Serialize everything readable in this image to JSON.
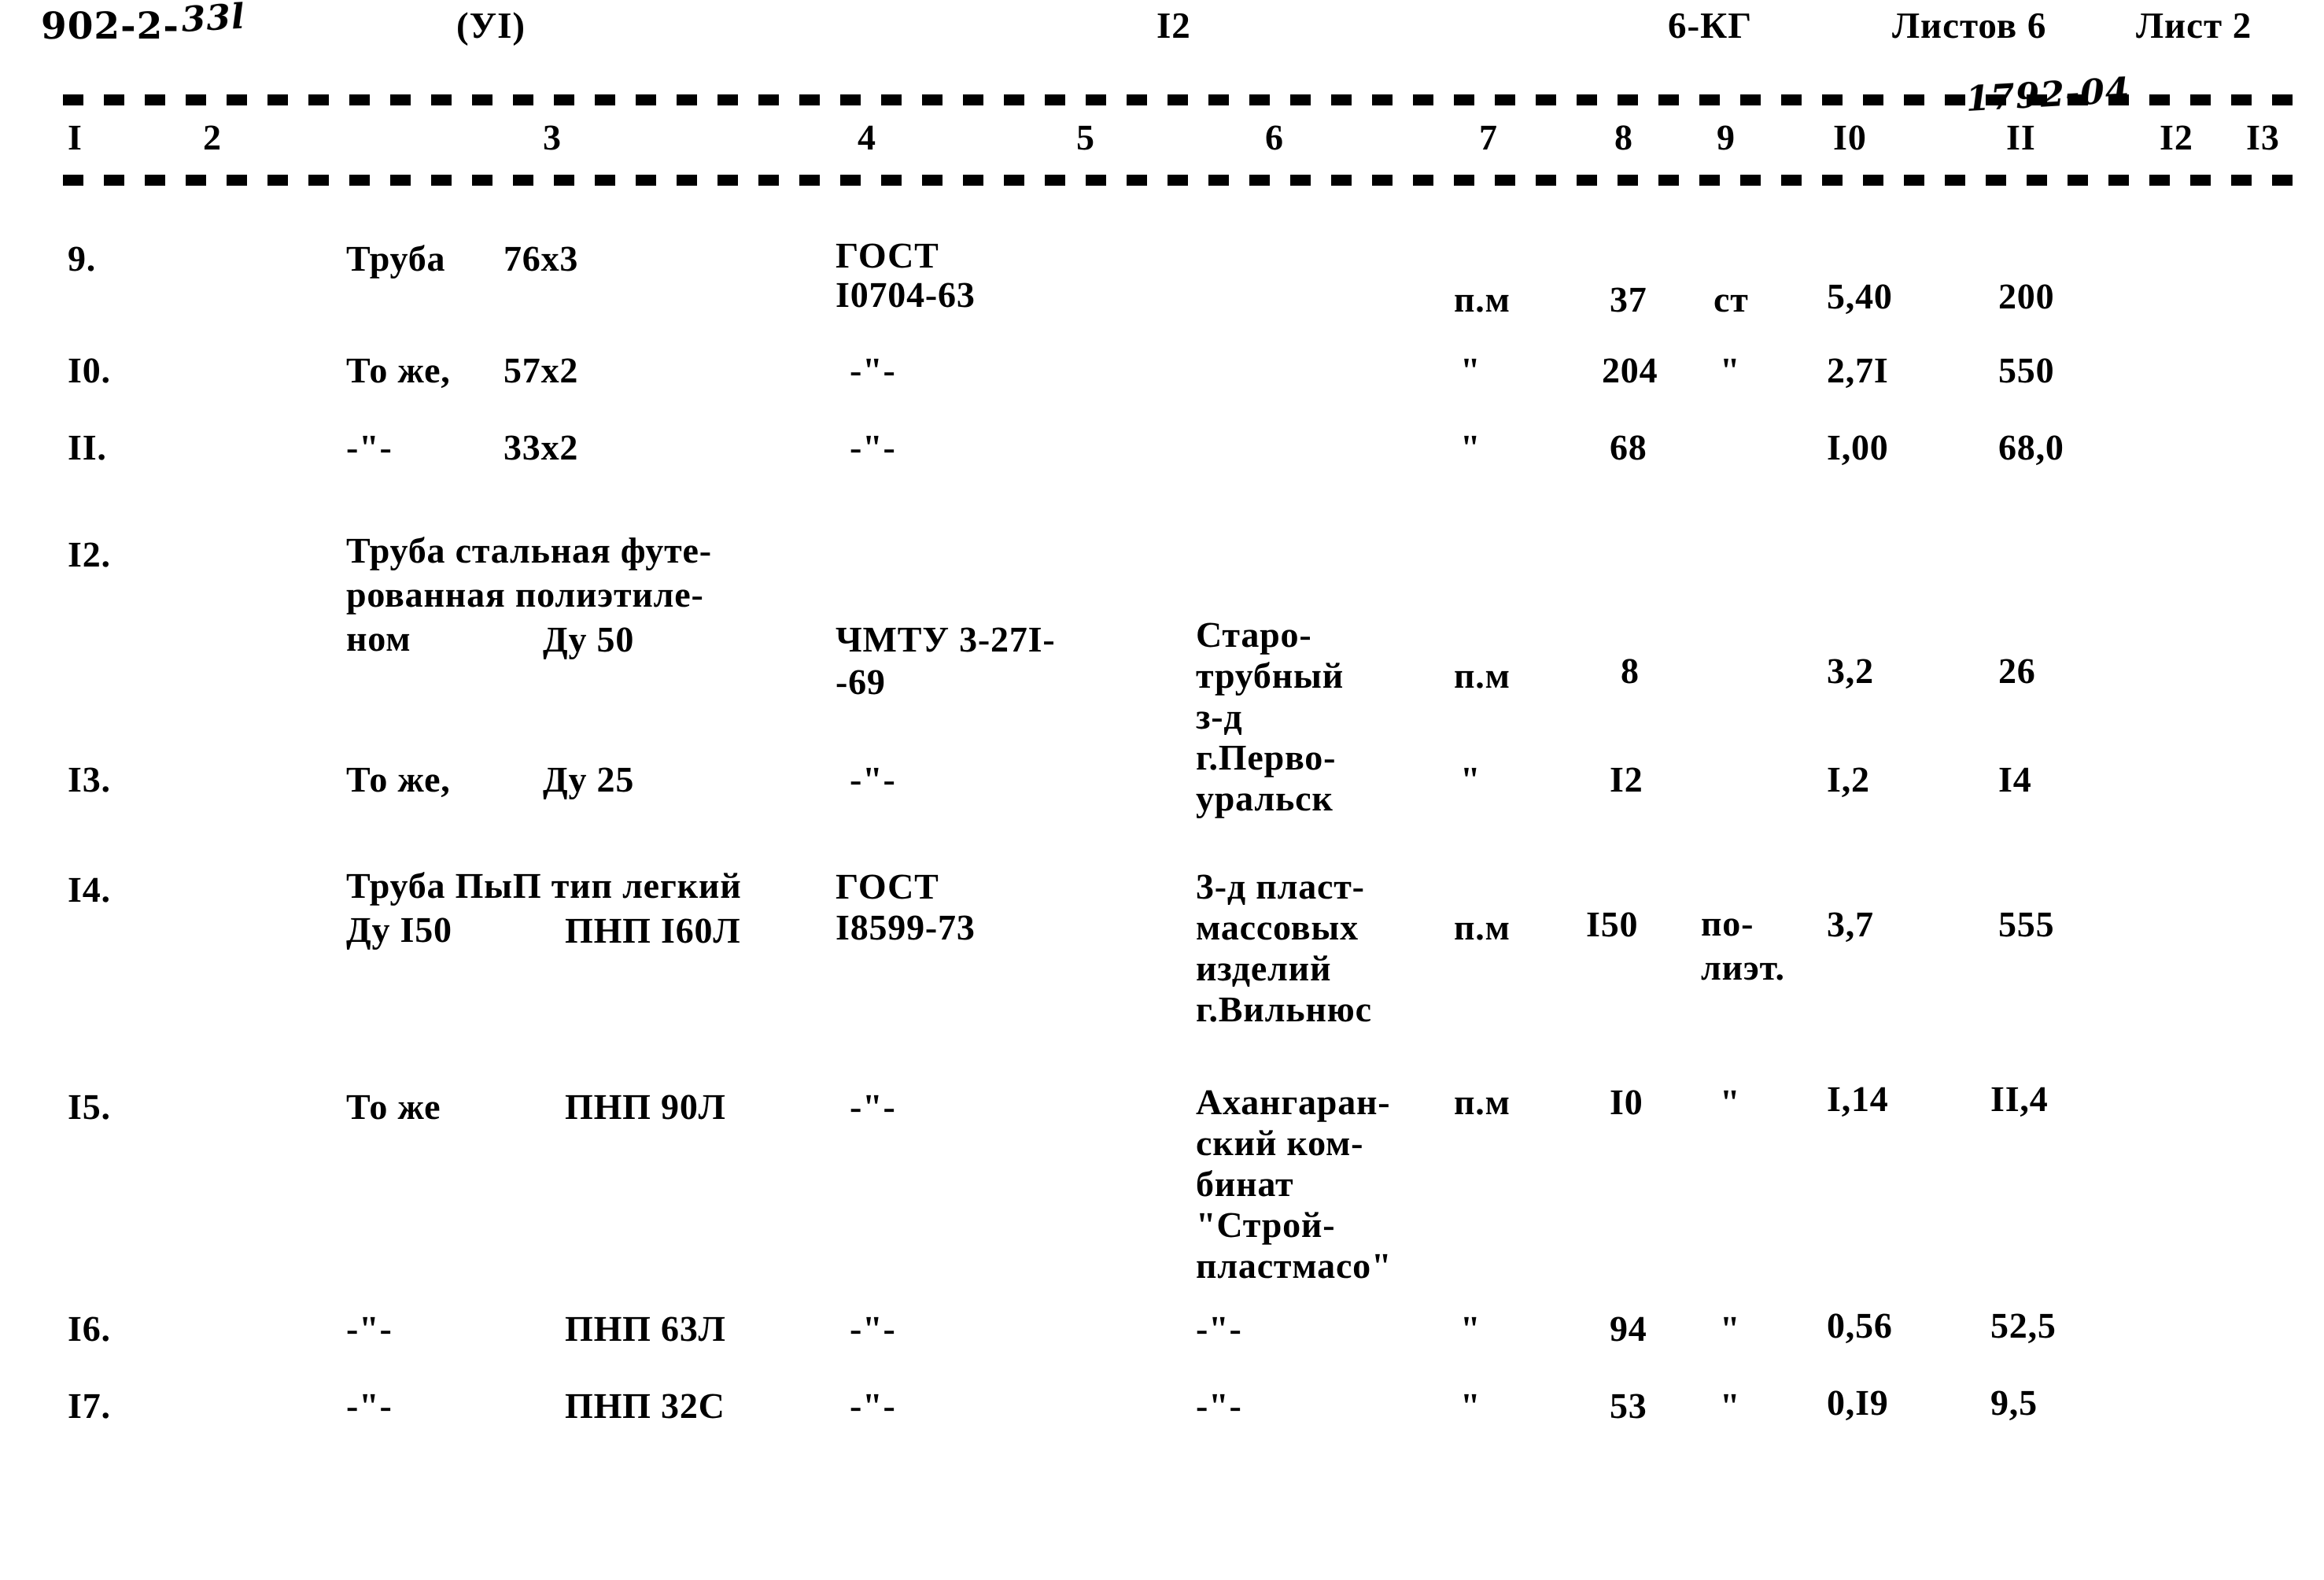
{
  "document": {
    "series_code": "902-2-",
    "series_code_handwritten": "33l",
    "section": "(УI)",
    "center_number": "I2",
    "mark": "6-КГ",
    "sheets_total_label": "Листов 6",
    "sheet_label": "Лист 2",
    "handwritten_note": "1792-04"
  },
  "table": {
    "column_numbers": [
      "I",
      "2",
      "3",
      "4",
      "5",
      "6",
      "7",
      "8",
      "9",
      "I0",
      "II",
      "I2",
      "I3"
    ],
    "ditto_mark": "-\"-",
    "quote_mark": "\"",
    "rows": [
      {
        "num": "9.",
        "c3a": "Труба",
        "c3b": "76х3",
        "c4": [
          "ГОСТ",
          "I0704-63"
        ],
        "c5": "",
        "c6": [],
        "c7": "п.м",
        "c8": "37",
        "c9": "ст",
        "c10": "5,40",
        "c11": "200",
        "c12": "",
        "c13": ""
      },
      {
        "num": "I0.",
        "c3a": "То же,",
        "c3b": "57х2",
        "c4": [
          "-\"-"
        ],
        "c5": "",
        "c6": [],
        "c7": "\"",
        "c8": "204",
        "c9": "\"",
        "c10": "2,7I",
        "c11": "550",
        "c12": "",
        "c13": ""
      },
      {
        "num": "II.",
        "c3a": "-\"-",
        "c3b": "33х2",
        "c4": [
          "-\"-"
        ],
        "c5": "",
        "c6": [],
        "c7": "\"",
        "c8": "68",
        "c9": "",
        "c10": "I,00",
        "c11": "68,0",
        "c12": "",
        "c13": ""
      },
      {
        "num": "I2.",
        "c3a": "Труба стальная футе-\nрованная полиэтиле-\nном",
        "c3b": "Ду 50",
        "c4": [
          "ЧМТУ 3-27I-",
          "-69"
        ],
        "c5": "",
        "c6": [
          "Старо-",
          "трубный",
          "з-д",
          "г.Перво-",
          "уральск"
        ],
        "c7": "п.м",
        "c8": "8",
        "c9": "",
        "c10": "3,2",
        "c11": "26",
        "c12": "",
        "c13": ""
      },
      {
        "num": "I3.",
        "c3a": "То же,",
        "c3b": "Ду 25",
        "c4": [
          "-\"-"
        ],
        "c5": "",
        "c6": [],
        "c7": "\"",
        "c8": "I2",
        "c9": "",
        "c10": "I,2",
        "c11": "I4",
        "c12": "",
        "c13": ""
      },
      {
        "num": "I4.",
        "c3a": "Труба ПыП тип легкий\nДу I50",
        "c3b": "ПНП I60Л",
        "c4": [
          "ГОСТ",
          "I8599-73"
        ],
        "c5": "",
        "c6": [
          "3-д пласт-",
          "массовых",
          "изделий",
          "г.Вильнюс"
        ],
        "c7": "п.м",
        "c8": "I50",
        "c9": "по-\nлиэт.",
        "c10": "3,7",
        "c11": "555",
        "c12": "",
        "c13": ""
      },
      {
        "num": "I5.",
        "c3a": "То же",
        "c3b": "ПНП 90Л",
        "c4": [
          "-\"-"
        ],
        "c5": "",
        "c6": [
          "Ахангаран-",
          "ский ком-",
          "бинат",
          "\"Строй-",
          "пластмасо\""
        ],
        "c7": "п.м",
        "c8": "I0",
        "c9": "\"",
        "c10": "I,14",
        "c11": "II,4",
        "c12": "",
        "c13": ""
      },
      {
        "num": "I6.",
        "c3a": "-\"-",
        "c3b": "ПНП 63Л",
        "c4": [
          "-\"-"
        ],
        "c5": "",
        "c6": [
          "-\"-"
        ],
        "c7": "\"",
        "c8": "94",
        "c9": "\"",
        "c10": "0,56",
        "c11": "52,5",
        "c12": "",
        "c13": ""
      },
      {
        "num": "I7.",
        "c3a": "-\"-",
        "c3b": "ПНП 32С",
        "c4": [
          "-\"-"
        ],
        "c5": "",
        "c6": [
          "-\"-"
        ],
        "c7": "\"",
        "c8": "53",
        "c9": "\"",
        "c10": "0,I9",
        "c11": "9,5",
        "c12": "",
        "c13": ""
      }
    ]
  }
}
